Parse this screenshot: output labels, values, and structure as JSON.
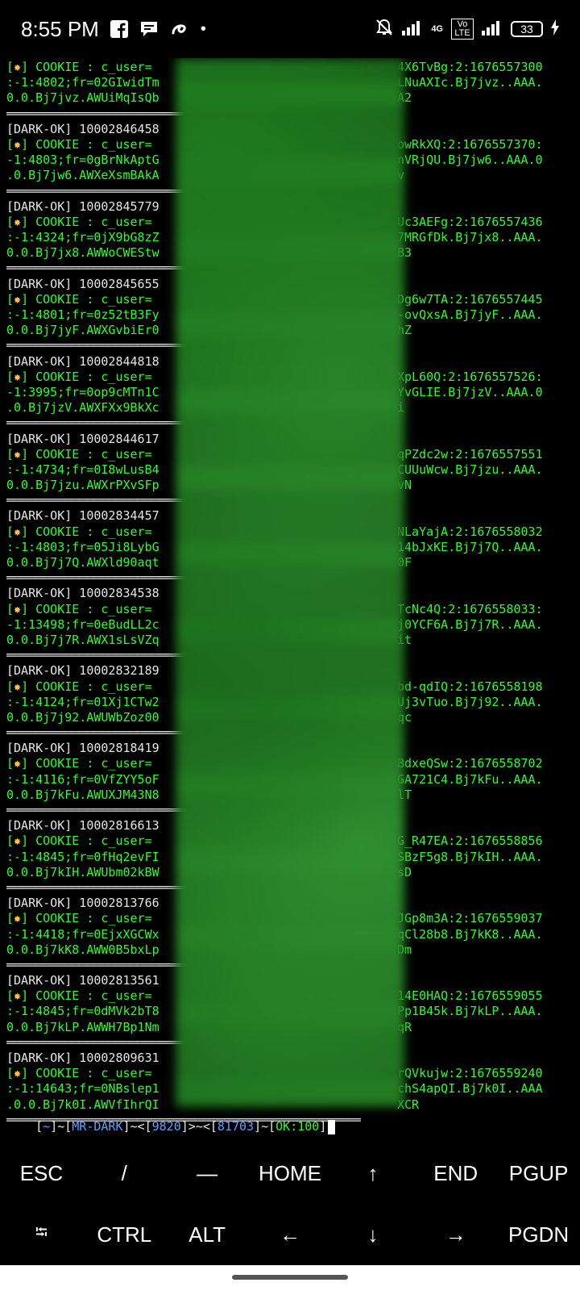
{
  "status_bar": {
    "time": "8:55 PM",
    "dot": "•",
    "network_label": "4G",
    "volte_label": "Vo LTE",
    "battery": "33"
  },
  "terminal": {
    "lines": [
      {
        "type": "cookie",
        "a": "[",
        "b": "] COOKIE : c_user=",
        "right": "4X6TvBg:2:1676557300"
      },
      {
        "type": "text",
        "left": ":-1:4802;fr=02GIwidTm",
        "right": "LNuAXIc.Bj7jvz..AAA."
      },
      {
        "type": "text",
        "left": "0.0.Bj7jvz.AWUiMqIsQb",
        "right": "A2"
      },
      {
        "type": "rule"
      },
      {
        "type": "dark",
        "left": "[DARK-OK] 10002846458"
      },
      {
        "type": "cookie",
        "a": "[",
        "b": "] COOKIE : c_user=",
        "right": "owRkXQ:2:1676557370:"
      },
      {
        "type": "text",
        "left": "-1:4803;fr=0gBrNkAptG",
        "right": "nVRjQU.Bj7jw6..AAA.0"
      },
      {
        "type": "text",
        "left": ".0.Bj7jw6.AWXeXsmBAkA",
        "right": "v"
      },
      {
        "type": "rule"
      },
      {
        "type": "dark",
        "left": "[DARK-OK] 10002845779"
      },
      {
        "type": "cookie",
        "a": "[",
        "b": "] COOKIE : c_user=",
        "right": "Uc3AEFg:2:1676557436"
      },
      {
        "type": "text",
        "left": ":-1:4324;fr=0jX9bG8zZ",
        "right": "7MRGfDk.Bj7jx8..AAA."
      },
      {
        "type": "text",
        "left": "0.0.Bj7jx8.AWWoCWEStw",
        "right": "B3"
      },
      {
        "type": "rule"
      },
      {
        "type": "dark",
        "left": "[DARK-OK] 10002845655"
      },
      {
        "type": "cookie",
        "a": "[",
        "b": "] COOKIE : c_user=",
        "right": "Dg6w7TA:2:1676557445"
      },
      {
        "type": "text",
        "left": ":-1:4801;fr=0z52tB3Fy",
        "right": "-ovQxsA.Bj7jyF..AAA."
      },
      {
        "type": "text",
        "left": "0.0.Bj7jyF.AWXGvbiEr0",
        "right": "hZ"
      },
      {
        "type": "rule"
      },
      {
        "type": "dark",
        "left": "[DARK-OK] 10002844818"
      },
      {
        "type": "cookie",
        "a": "[",
        "b": "] COOKIE : c_user=",
        "right": "XpL60Q:2:1676557526:"
      },
      {
        "type": "text",
        "left": "-1:3995;fr=0op9cMTn1C",
        "right": "YvGLIE.Bj7jzV..AAA.0"
      },
      {
        "type": "text",
        "left": ".0.Bj7jzV.AWXFXx9BkXc",
        "right": "i"
      },
      {
        "type": "rule"
      },
      {
        "type": "dark",
        "left": "[DARK-OK] 10002844617"
      },
      {
        "type": "cookie",
        "a": "[",
        "b": "] COOKIE : c_user=",
        "right": "qPZdc2w:2:1676557551"
      },
      {
        "type": "text",
        "left": ":-1:4734;fr=0I8wLusB4",
        "right": "CUUuWcw.Bj7jzu..AAA."
      },
      {
        "type": "text",
        "left": "0.0.Bj7jzu.AWXrPXvSFp",
        "right": "vN"
      },
      {
        "type": "rule"
      },
      {
        "type": "dark",
        "left": "[DARK-OK] 10002834457"
      },
      {
        "type": "cookie",
        "a": "[",
        "b": "] COOKIE : c_user=",
        "right": "NLaYajA:2:1676558032"
      },
      {
        "type": "text",
        "left": ":-1:4803;fr=05Ji8LybG",
        "right": "14bJxKE.Bj7j7Q..AAA."
      },
      {
        "type": "text",
        "left": "0.0.Bj7j7Q.AWXld90aqt",
        "right": "0F"
      },
      {
        "type": "rule"
      },
      {
        "type": "dark",
        "left": "[DARK-OK] 10002834538"
      },
      {
        "type": "cookie",
        "a": "[",
        "b": "] COOKIE : c_user=",
        "right": "TcNc4Q:2:1676558033:"
      },
      {
        "type": "text",
        "left": "-1:13498;fr=0eBudLL2c",
        "right": "j0YCF6A.Bj7j7R..AAA."
      },
      {
        "type": "text",
        "left": "0.0.Bj7j7R.AWX1sLsVZq",
        "right": "it"
      },
      {
        "type": "rule"
      },
      {
        "type": "dark",
        "left": "[DARK-OK] 10002832189"
      },
      {
        "type": "cookie",
        "a": "[",
        "b": "] COOKIE : c_user=",
        "right": "bd-qdIQ:2:1676558198"
      },
      {
        "type": "text",
        "left": ":-1:4124;fr=01Xj1CTw2",
        "right": "Uj3vTuo.Bj7j92..AAA."
      },
      {
        "type": "text",
        "left": "0.0.Bj7j92.AWUWbZoz00",
        "right": "qc"
      },
      {
        "type": "rule"
      },
      {
        "type": "dark",
        "left": "[DARK-OK] 10002818419"
      },
      {
        "type": "cookie",
        "a": "[",
        "b": "] COOKIE : c_user=",
        "right": "BdxeQSw:2:1676558702"
      },
      {
        "type": "text",
        "left": ":-1:4116;fr=0VfZYY5oF",
        "right": "GA721C4.Bj7kFu..AAA."
      },
      {
        "type": "text",
        "left": "0.0.Bj7kFu.AWUXJM43N8",
        "right": "lT"
      },
      {
        "type": "rule"
      },
      {
        "type": "dark",
        "left": "[DARK-OK] 10002816613"
      },
      {
        "type": "cookie",
        "a": "[",
        "b": "] COOKIE : c_user=",
        "right": "G_R47EA:2:1676558856"
      },
      {
        "type": "text",
        "left": ":-1:4845;fr=0fHq2evFI",
        "right": "SBzF5g8.Bj7kIH..AAA."
      },
      {
        "type": "text",
        "left": "0.0.Bj7kIH.AWUbm02kBW",
        "right": "sD"
      },
      {
        "type": "rule"
      },
      {
        "type": "dark",
        "left": "[DARK-OK] 10002813766"
      },
      {
        "type": "cookie",
        "a": "[",
        "b": "] COOKIE : c_user=",
        "right": "JGp8m3A:2:1676559037"
      },
      {
        "type": "text",
        "left": ":-1:4418;fr=0EjxXGCWx",
        "right": "qCl28b8.Bj7kK8..AAA."
      },
      {
        "type": "text",
        "left": "0.0.Bj7kK8.AWW0B5bxLp",
        "right": "Dm"
      },
      {
        "type": "rule"
      },
      {
        "type": "dark",
        "left": "[DARK-OK] 10002813561"
      },
      {
        "type": "cookie",
        "a": "[",
        "b": "] COOKIE : c_user=",
        "right": "14E0HAQ:2:1676559055"
      },
      {
        "type": "text",
        "left": ":-1:4845;fr=0dMVk2bT8",
        "right": "Pp1B45k.Bj7kLP..AAA."
      },
      {
        "type": "text",
        "left": "0.0.Bj7kLP.AWWH7Bp1Nm",
        "right": "qR"
      },
      {
        "type": "rule"
      },
      {
        "type": "dark",
        "left": "[DARK-OK] 10002809631"
      },
      {
        "type": "cookie",
        "a": "[",
        "b": "] COOKIE : c_user=",
        "right": "rQVkujw:2:1676559240"
      },
      {
        "type": "text",
        "left": ":-1:14643;fr=0NBslep1",
        "right": "chS4apQI.Bj7k0I..AAA"
      },
      {
        "type": "text",
        "left": ".0.0.Bj7k0I.AWVfIhrQI",
        "right": "XCR"
      },
      {
        "type": "rule"
      }
    ],
    "prompt": {
      "open": "[",
      "tilde": "~",
      "close_sep": "]~[",
      "user": "MR-DARK",
      "mid1": "]~<[",
      "count1": "9820",
      "mid2": "]>~<[",
      "count2": "81703",
      "mid3": "]~[",
      "ok": "OK:100",
      "end": "]"
    }
  },
  "extra_keys": {
    "row1": [
      "ESC",
      "/",
      "—",
      "HOME",
      "↑",
      "END",
      "PGUP"
    ],
    "row2": [
      "⭾",
      "CTRL",
      "ALT",
      "←",
      "↓",
      "→",
      "PGDN"
    ]
  }
}
